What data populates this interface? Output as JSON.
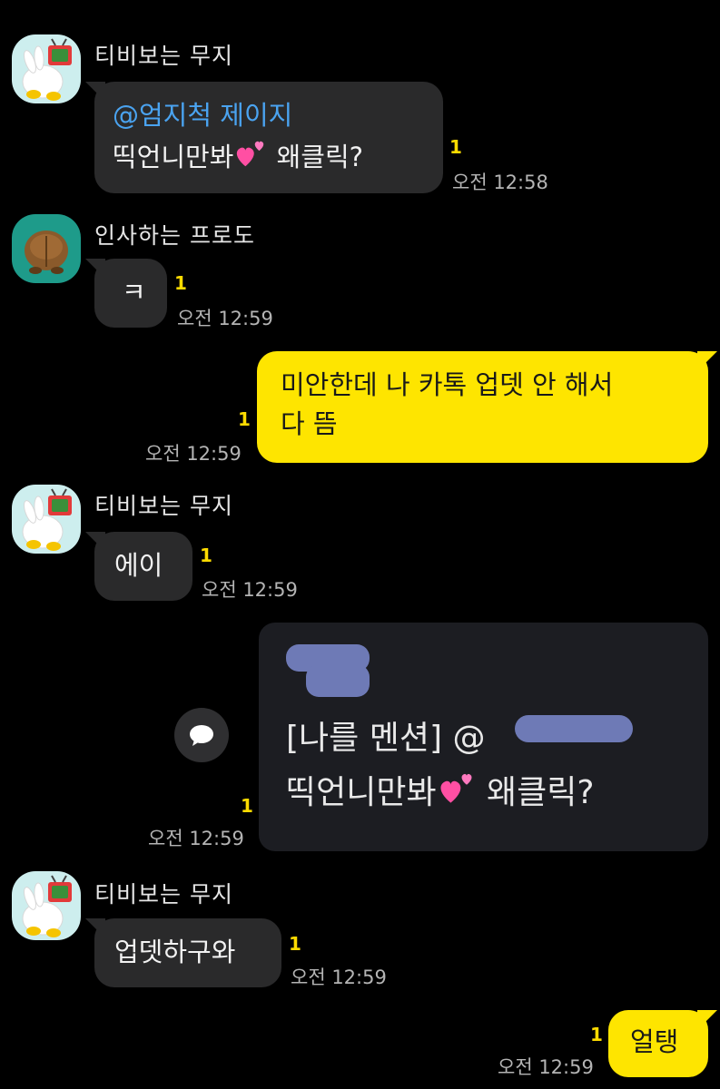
{
  "colors": {
    "background": "#000000",
    "incoming_bubble": "#2a2a2b",
    "outgoing_bubble": "#fee500",
    "mention": "#4aa3f0",
    "unread": "#fedb00",
    "blurred_name": "#6e7ab6"
  },
  "messages": [
    {
      "sender": "티비보는 무지",
      "mention": "@엄지척 제이지",
      "text_a": "띡언니만봐",
      "emoji": "two-hearts-icon",
      "text_b": " 왜클릭?",
      "unread": "1",
      "time": "오전 12:58"
    },
    {
      "sender": "인사하는 프로도",
      "text": "ㅋ",
      "unread": "1",
      "time": "오전 12:59"
    },
    {
      "outgoing": true,
      "line1": "미안한데 나 카톡 업뎃 안 해서",
      "line2": "다 뜸",
      "unread": "1",
      "time": "오전 12:59"
    },
    {
      "sender": "티비보는 무지",
      "text": "에이",
      "unread": "1",
      "time": "오전 12:59"
    },
    {
      "outgoing": true,
      "image": {
        "line1_a": "[나를 멘션] @",
        "line2_a": "띡언니만봐",
        "emoji": "two-hearts-icon",
        "line2_b": " 왜클릭?"
      },
      "share_icon": "speech-bubble-icon",
      "unread": "1",
      "time": "오전 12:59"
    },
    {
      "sender": "티비보는 무지",
      "text": "업뎃하구와",
      "unread": "1",
      "time": "오전 12:59"
    },
    {
      "outgoing": true,
      "text": "얼탱",
      "unread": "1",
      "time": "오전 12:59"
    }
  ]
}
